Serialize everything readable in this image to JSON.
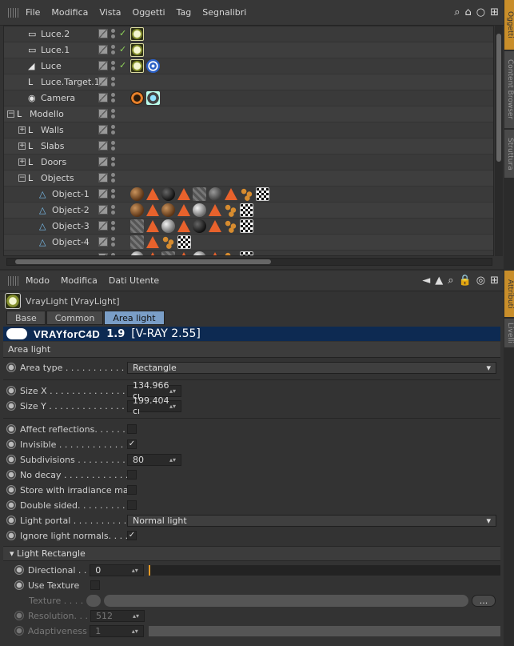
{
  "object_manager": {
    "menu": [
      "File",
      "Modifica",
      "Vista",
      "Oggetti",
      "Tag",
      "Segnalibri"
    ],
    "rows": [
      {
        "name": "Luce.2",
        "indent": 1,
        "icon": "light-icon",
        "tags": [
          "vray"
        ]
      },
      {
        "name": "Luce.1",
        "indent": 1,
        "icon": "light-icon",
        "tags": [
          "vray"
        ]
      },
      {
        "name": "Luce",
        "indent": 1,
        "icon": "spotlight-icon",
        "tags": [
          "vray",
          "target"
        ]
      },
      {
        "name": "Luce.Target.1",
        "indent": 1,
        "icon": "null-icon",
        "tags": []
      },
      {
        "name": "Camera",
        "indent": 1,
        "icon": "camera-icon",
        "tags": [
          "nope",
          "cam"
        ]
      },
      {
        "name": "Modello",
        "indent": 0,
        "icon": "null-icon",
        "expander": "-",
        "tags": []
      },
      {
        "name": "Walls",
        "indent": 1,
        "icon": "null-icon",
        "expander": "+",
        "tags": []
      },
      {
        "name": "Slabs",
        "indent": 1,
        "icon": "null-icon",
        "expander": "+",
        "tags": []
      },
      {
        "name": "Doors",
        "indent": 1,
        "icon": "null-icon",
        "expander": "+",
        "tags": []
      },
      {
        "name": "Objects",
        "indent": 1,
        "icon": "null-icon",
        "expander": "-",
        "tags": []
      },
      {
        "name": "Object-1",
        "indent": 2,
        "icon": "polygon-icon",
        "tags": [
          "sph-brown",
          "tri",
          "sph-black",
          "tri",
          "hatch",
          "sph-dgray",
          "tri",
          "beads",
          "checker"
        ]
      },
      {
        "name": "Object-2",
        "indent": 2,
        "icon": "polygon-icon",
        "tags": [
          "sph-brown",
          "tri",
          "sph-brown",
          "tri",
          "sph-gray",
          "tri",
          "beads",
          "checker"
        ]
      },
      {
        "name": "Object-3",
        "indent": 2,
        "icon": "polygon-icon",
        "tags": [
          "hatch",
          "tri",
          "sph-gray",
          "tri",
          "sph-black",
          "tri",
          "beads",
          "checker"
        ]
      },
      {
        "name": "Object-4",
        "indent": 2,
        "icon": "polygon-icon",
        "tags": [
          "hatch",
          "tri",
          "beads",
          "checker"
        ]
      },
      {
        "name": "",
        "indent": 2,
        "icon": "polygon-icon",
        "tags": [
          "sph-gray",
          "tri",
          "hatch",
          "tri",
          "sph-gray",
          "tri",
          "beads",
          "checker"
        ]
      }
    ],
    "side_tabs": [
      "Oggetti",
      "Content Browser",
      "Struttura"
    ]
  },
  "attributes": {
    "menu": [
      "Modo",
      "Modifica",
      "Dati Utente"
    ],
    "object_label": "VrayLight [VrayLight]",
    "tabs": [
      {
        "label": "Base",
        "active": false
      },
      {
        "label": "Common",
        "active": false
      },
      {
        "label": "Area light",
        "active": true
      }
    ],
    "banner": {
      "brand": "VRAYforC4D",
      "version": "1.9",
      "vray": "[V-RAY 2.55]"
    },
    "section": "Area light",
    "area_type": {
      "label": "Area type . . . . . . . . . . . . . . .",
      "value": "Rectangle"
    },
    "size_x": {
      "label": "Size X . . . . . . . . . . . . . . . . . . .",
      "value": "134.966 cı"
    },
    "size_y": {
      "label": "Size Y . . . . . . . . . . . . . . . . . . .",
      "value": "199.404 cı"
    },
    "affect_reflections": {
      "label": "Affect reflections. . . . . . . .",
      "checked": ""
    },
    "invisible": {
      "label": "Invisible . . . . . . . . . . . . . . . .",
      "checked": "✓"
    },
    "subdivisions": {
      "label": "Subdivisions . . . . . . . . . . . .",
      "value": "80"
    },
    "no_decay": {
      "label": "No decay . . . . . . . . . . . . . . .",
      "checked": ""
    },
    "store_irradiance": {
      "label": "Store with irradiance map",
      "checked": ""
    },
    "double_sided": {
      "label": "Double sided. . . . . . . . . . . .",
      "checked": ""
    },
    "light_portal": {
      "label": "Light portal . . . . . . . . . . . .",
      "value": "Normal light"
    },
    "ignore_normals": {
      "label": "Ignore light normals. . . . .",
      "checked": "✓"
    },
    "subsection": "Light Rectangle",
    "directional": {
      "label": "Directional . .",
      "value": "0"
    },
    "use_texture": {
      "label": "Use Texture",
      "checked": ""
    },
    "texture": {
      "label": "Texture . . . . .",
      "button": "..."
    },
    "resolution": {
      "label": "Resolution. . .",
      "value": "512"
    },
    "adaptiveness": {
      "label": "Adaptiveness",
      "value": "1"
    },
    "side_tabs": [
      "Attributi",
      "Livelli"
    ]
  },
  "colors": {
    "accent": "#7a9ec7",
    "banner": "#0d2a52",
    "slider_mark": "#e69a25"
  }
}
